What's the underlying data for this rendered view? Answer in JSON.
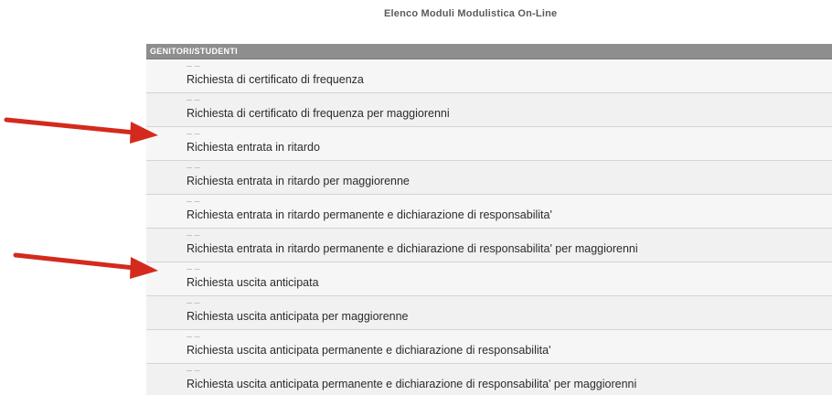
{
  "page": {
    "title": "Elenco Moduli Modulistica On-Line"
  },
  "section": {
    "header": "GENITORI/STUDENTI",
    "rows": [
      {
        "meta": "— —",
        "label": "Richiesta di certificato di frequenza"
      },
      {
        "meta": "— —",
        "label": "Richiesta di certificato di frequenza per maggiorenni"
      },
      {
        "meta": "— —",
        "label": "Richiesta entrata in ritardo"
      },
      {
        "meta": "— —",
        "label": "Richiesta entrata in ritardo per maggiorenne"
      },
      {
        "meta": "— —",
        "label": "Richiesta entrata in ritardo permanente e dichiarazione di responsabilita'"
      },
      {
        "meta": "— —",
        "label": "Richiesta entrata in ritardo permanente e dichiarazione di responsabilita' per maggiorenni"
      },
      {
        "meta": "— —",
        "label": "Richiesta uscita anticipata"
      },
      {
        "meta": "— —",
        "label": "Richiesta uscita anticipata per maggiorenne"
      },
      {
        "meta": "— —",
        "label": "Richiesta uscita anticipata permanente e dichiarazione di responsabilita'"
      },
      {
        "meta": "— —",
        "label": "Richiesta uscita anticipata permanente e dichiarazione di responsabilita' per maggiorenni"
      }
    ]
  },
  "annotations": {
    "arrow_color": "#d42a1e",
    "arrows": [
      {
        "icon": "red-arrow-right-icon",
        "points_to": "Richiesta entrata in ritardo"
      },
      {
        "icon": "red-arrow-right-icon",
        "points_to": "Richiesta uscita anticipata"
      }
    ]
  }
}
